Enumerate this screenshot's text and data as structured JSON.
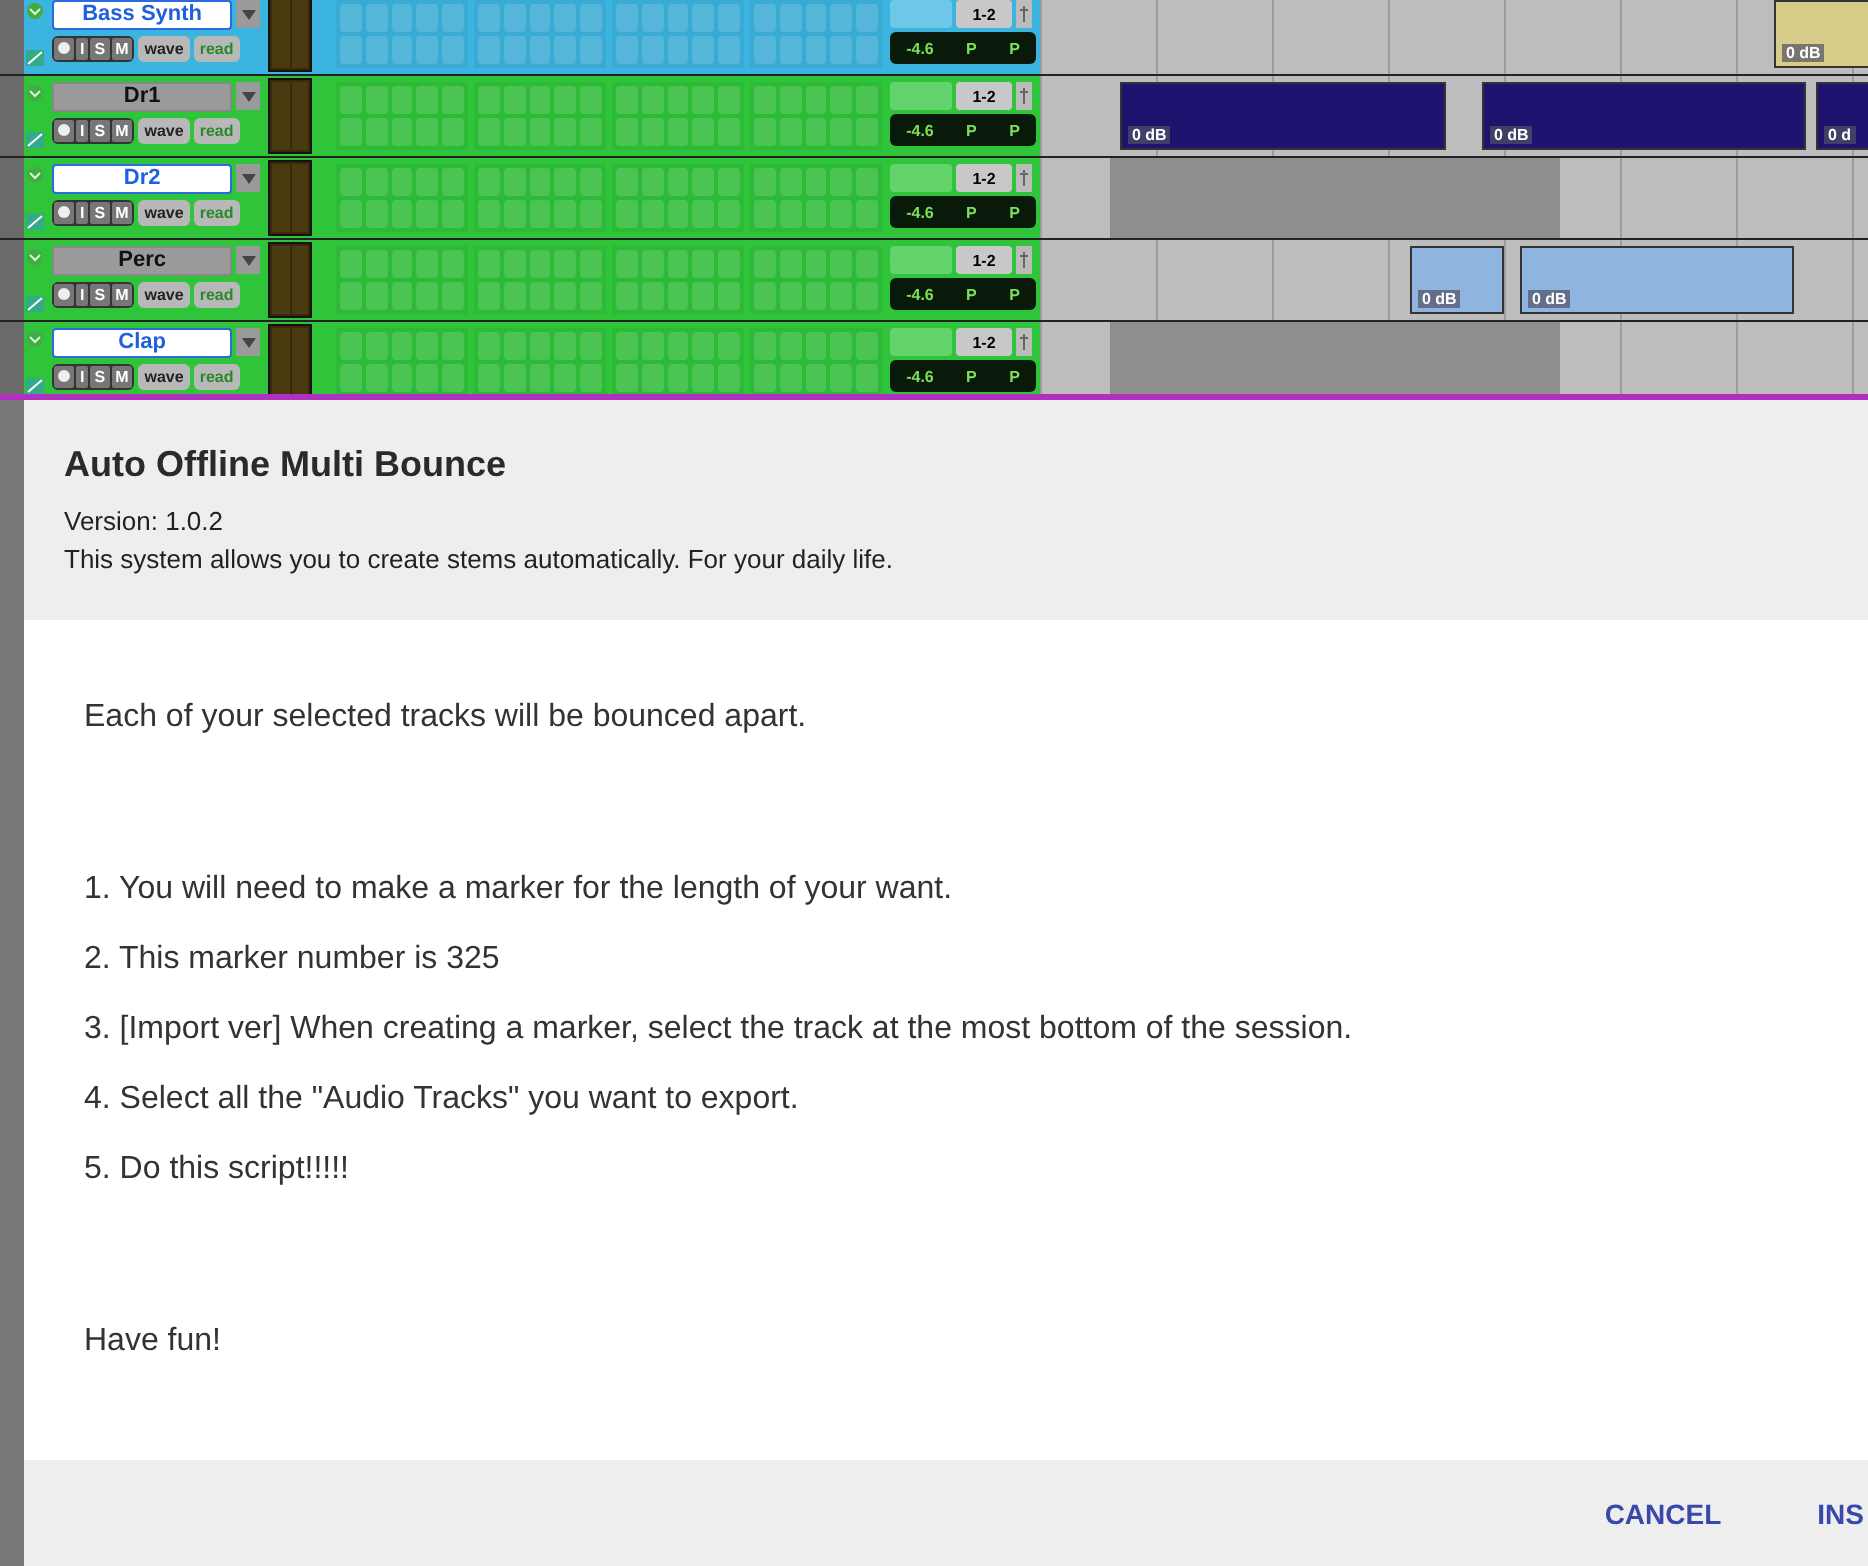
{
  "tracks": [
    {
      "name": "Bass Synth",
      "selected": true,
      "color": "#3cb4e0",
      "buttons": [
        "I",
        "S",
        "M"
      ],
      "view": "wave",
      "automation": "read",
      "output": "1-2",
      "volume": "-4.6",
      "pan": [
        "P",
        "P"
      ],
      "clips": [
        {
          "label": "0 dB",
          "color": "#d8cc8a"
        }
      ]
    },
    {
      "name": "Dr1",
      "selected": false,
      "color": "#2fc43a",
      "buttons": [
        "I",
        "S",
        "M"
      ],
      "view": "wave",
      "automation": "read",
      "output": "1-2",
      "volume": "-4.6",
      "pan": [
        "P",
        "P"
      ],
      "clips": [
        {
          "label": "0 dB",
          "color": "#1e1470"
        },
        {
          "label": "0 dB",
          "color": "#1e1470"
        },
        {
          "label": "0 d",
          "color": "#1e1470"
        }
      ]
    },
    {
      "name": "Dr2",
      "selected": true,
      "color": "#2fc43a",
      "buttons": [
        "I",
        "S",
        "M"
      ],
      "view": "wave",
      "automation": "read",
      "output": "1-2",
      "volume": "-4.6",
      "pan": [
        "P",
        "P"
      ]
    },
    {
      "name": "Perc",
      "selected": false,
      "color": "#2fc43a",
      "buttons": [
        "I",
        "S",
        "M"
      ],
      "view": "wave",
      "automation": "read",
      "output": "1-2",
      "volume": "-4.6",
      "pan": [
        "P",
        "P"
      ],
      "clips": [
        {
          "label": "0 dB",
          "color": "#8fb4e0"
        },
        {
          "label": "0 dB",
          "color": "#8fb4e0"
        }
      ]
    },
    {
      "name": "Clap",
      "selected": true,
      "color": "#2fc43a",
      "buttons": [
        "I",
        "S",
        "M"
      ],
      "view": "wave",
      "automation": "read",
      "output": "1-2",
      "volume": "-4.6",
      "pan": [
        "P",
        "P"
      ]
    }
  ],
  "dialog": {
    "title": "Auto Offline Multi Bounce",
    "version": "Version: 1.0.2",
    "description": "This system allows you to create stems automatically. For your daily life.",
    "intro": "Each of your selected tracks will be bounced apart.",
    "steps": [
      "1. You will need to make a marker for the length of your want.",
      "2. This marker number is 325",
      "3. [Import ver] When creating a marker, select the track at the most bottom of the session.",
      "4. Select all the \"Audio Tracks\" you want to export.",
      "5. Do this script!!!!!"
    ],
    "closing": "Have fun!",
    "buttons": [
      "CANCEL",
      "INS"
    ]
  }
}
